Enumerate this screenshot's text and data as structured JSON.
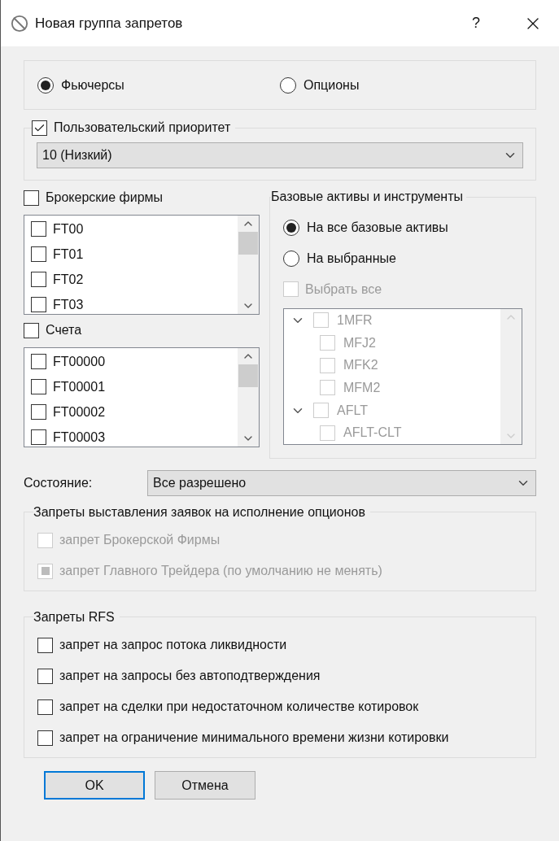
{
  "window": {
    "title": "Новая группа запретов",
    "help": "?"
  },
  "instrument_type": [
    {
      "label": "Фьючерсы",
      "selected": true
    },
    {
      "label": "Опционы",
      "selected": false
    }
  ],
  "priority": {
    "label": "Пользовательский приоритет",
    "checked": true,
    "value": "10 (Низкий)"
  },
  "firms": {
    "label": "Брокерские фирмы",
    "checked": false,
    "items": [
      {
        "label": "FT00",
        "checked": false
      },
      {
        "label": "FT01",
        "checked": false
      },
      {
        "label": "FT02",
        "checked": false
      },
      {
        "label": "FT03",
        "checked": false
      }
    ]
  },
  "accounts": {
    "label": "Счета",
    "checked": false,
    "items": [
      {
        "label": "FT00000",
        "checked": false
      },
      {
        "label": "FT00001",
        "checked": false
      },
      {
        "label": "FT00002",
        "checked": false
      },
      {
        "label": "FT00003",
        "checked": false
      }
    ]
  },
  "assets": {
    "title": "Базовые активы и инструменты",
    "scope": [
      {
        "label": "На все базовые активы",
        "selected": true
      },
      {
        "label": "На выбранные",
        "selected": false
      }
    ],
    "select_all": {
      "label": "Выбрать все",
      "checked": false,
      "disabled": true
    },
    "tree": [
      {
        "label": "1MFR",
        "checked": false,
        "expanded": true,
        "children": [
          {
            "label": "MFJ2",
            "checked": false
          },
          {
            "label": "MFK2",
            "checked": false
          },
          {
            "label": "MFM2",
            "checked": false
          }
        ]
      },
      {
        "label": "AFLT",
        "checked": false,
        "expanded": true,
        "children": [
          {
            "label": "AFLT-CLT",
            "checked": false
          }
        ]
      }
    ]
  },
  "state": {
    "label": "Состояние:",
    "value": "Все разрешено"
  },
  "option_bans": {
    "title": "Запреты  выставления заявок на исполнение опционов",
    "items": [
      {
        "label": "запрет Брокерской Фирмы",
        "checked": false,
        "indeterminate": false,
        "disabled": true
      },
      {
        "label": "запрет Главного Трейдера (по умолчанию не менять)",
        "checked": false,
        "indeterminate": true,
        "disabled": true
      }
    ]
  },
  "rfs_bans": {
    "title": "Запреты RFS",
    "items": [
      {
        "label": "запрет на запрос потока ликвидности",
        "checked": false
      },
      {
        "label": "запрет на запросы без автоподтверждения",
        "checked": false
      },
      {
        "label": "запрет на сделки при недостаточном количестве котировок",
        "checked": false
      },
      {
        "label": "запрет на ограничение минимального времени жизни котировки",
        "checked": false
      }
    ]
  },
  "buttons": [
    {
      "label": "OK",
      "selected": true
    },
    {
      "label": "Отмена",
      "selected": false
    }
  ]
}
